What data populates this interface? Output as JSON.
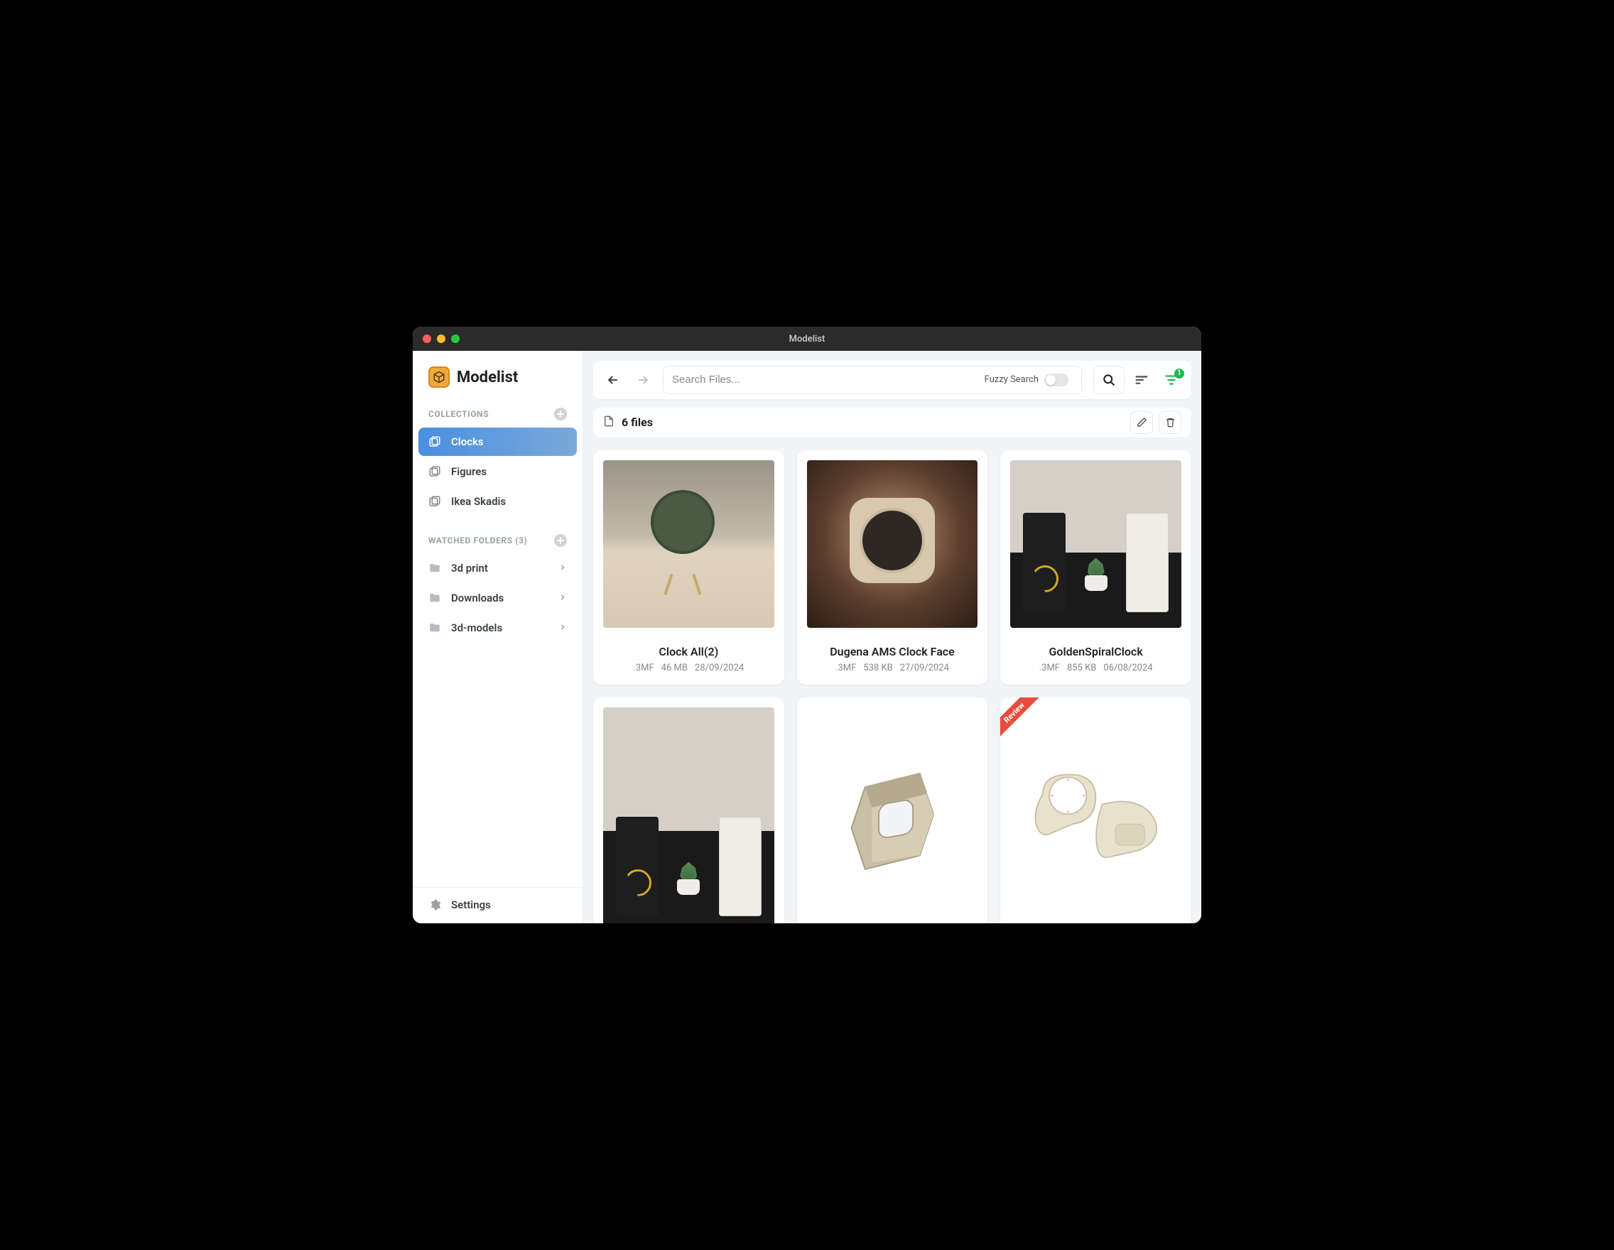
{
  "titlebar": {
    "title": "Modelist"
  },
  "brand": {
    "name": "Modelist"
  },
  "sidebar": {
    "sections": {
      "collections_label": "COLLECTIONS",
      "watched_label": "WATCHED FOLDERS (3)"
    },
    "collections": [
      {
        "label": "Clocks",
        "active": true
      },
      {
        "label": "Figures",
        "active": false
      },
      {
        "label": "Ikea Skadis",
        "active": false
      }
    ],
    "folders": [
      {
        "label": "3d print"
      },
      {
        "label": "Downloads"
      },
      {
        "label": "3d-models"
      }
    ],
    "settings_label": "Settings"
  },
  "search": {
    "placeholder": "Search Files...",
    "fuzzy_label": "Fuzzy Search",
    "filter_badge": "1"
  },
  "summary": {
    "count_label": "6 files"
  },
  "cards": [
    {
      "title": "Clock All(2)",
      "ext": ".3MF",
      "size": "46 MB",
      "date": "28/09/2024",
      "ribbon": null
    },
    {
      "title": "Dugena AMS Clock Face",
      "ext": ".3MF",
      "size": "538 KB",
      "date": "27/09/2024",
      "ribbon": null
    },
    {
      "title": "GoldenSpiralClock",
      "ext": ".3MF",
      "size": "855 KB",
      "date": "06/08/2024",
      "ribbon": null
    },
    {
      "title": "",
      "ext": "",
      "size": "",
      "date": "",
      "ribbon": null
    },
    {
      "title": "",
      "ext": "",
      "size": "",
      "date": "",
      "ribbon": null
    },
    {
      "title": "",
      "ext": "",
      "size": "",
      "date": "",
      "ribbon": "Review"
    }
  ]
}
